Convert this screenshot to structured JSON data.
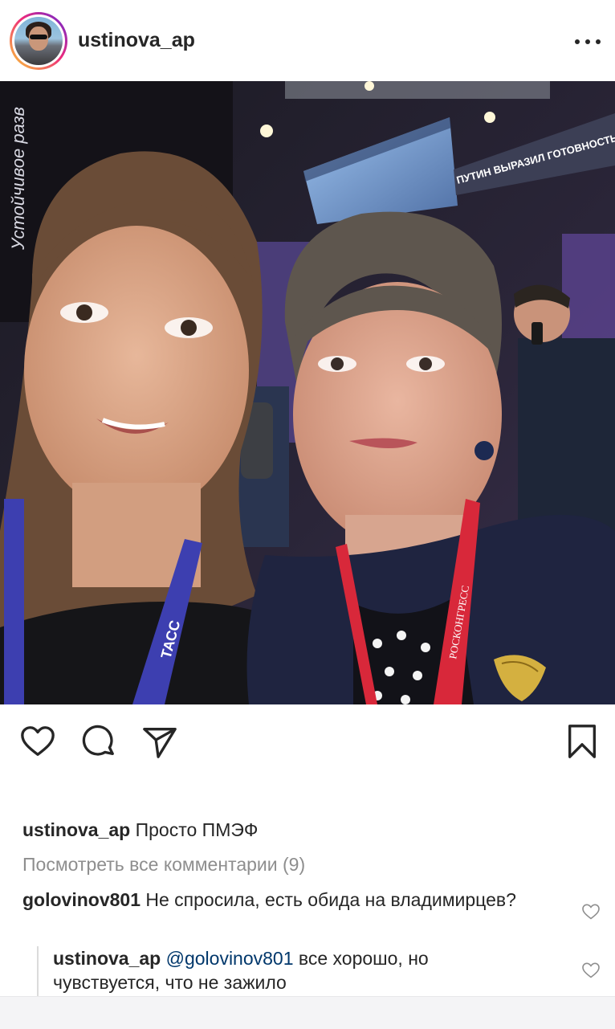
{
  "header": {
    "username": "ustinova_ap"
  },
  "actions": {
    "like": "heart-outline-icon",
    "comment": "comment-bubble-icon",
    "share": "paper-plane-icon",
    "save": "bookmark-icon"
  },
  "post": {
    "caption_user": "ustinova_ap",
    "caption_text": "Просто ПМЭФ",
    "view_all_comments": "Посмотреть все комментарии (9)"
  },
  "comments": [
    {
      "user": "golovinov801",
      "text": "Не спросила, есть обида на владимирцев?"
    }
  ],
  "reply": {
    "user": "ustinova_ap",
    "mention": "@golovinov801",
    "text": "все хорошо, но чувствуется, что не зажило"
  },
  "photo": {
    "banner_text": "ПУТИН ВЫРАЗИЛ ГОТОВНОСТЬ ПОДДЕРЖ",
    "left_sign": "Устойчивое разв",
    "lanyard_left": "ТАСС",
    "lanyard_right": "РОСКОНГРЕСС"
  },
  "colors": {
    "text": "#262626",
    "muted": "#8e8e8e",
    "mention": "#00376b",
    "lanyard_left": "#3d3fb0",
    "lanyard_right": "#d8283a"
  }
}
